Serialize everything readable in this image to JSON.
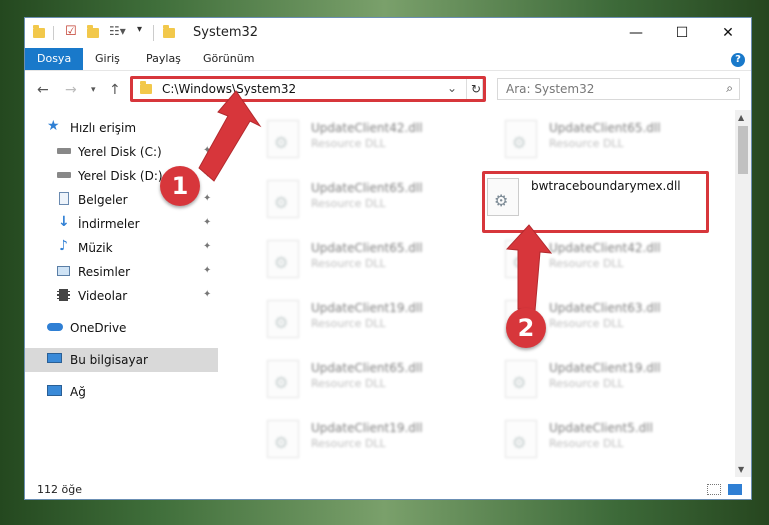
{
  "titlebar": {
    "title": "System32",
    "controls": {
      "minimize": "—",
      "maximize": "☐",
      "close": "✕"
    }
  },
  "ribbon": {
    "tabs": [
      "Dosya",
      "Giriş",
      "Paylaş",
      "Görünüm"
    ],
    "active_tab": "Dosya",
    "help": "?"
  },
  "nav": {
    "address": "C:\\Windows\\System32",
    "search_placeholder": "Ara: System32"
  },
  "sidebar": {
    "quick_access": "Hızlı erişim",
    "items": [
      {
        "label": "Yerel Disk (C:)",
        "icon": "drive-icon",
        "pinned": true
      },
      {
        "label": "Yerel Disk (D:)",
        "icon": "drive-icon",
        "pinned": true
      },
      {
        "label": "Belgeler",
        "icon": "documents-icon",
        "pinned": true
      },
      {
        "label": "İndirmeler",
        "icon": "download-icon",
        "pinned": true
      },
      {
        "label": "Müzik",
        "icon": "music-icon",
        "pinned": true
      },
      {
        "label": "Resimler",
        "icon": "pictures-icon",
        "pinned": true
      },
      {
        "label": "Videolar",
        "icon": "video-icon",
        "pinned": true
      }
    ],
    "onedrive": "OneDrive",
    "this_pc": "Bu bilgisayar",
    "network": "Ağ"
  },
  "files": [
    {
      "name": "UpdateClient42.dll",
      "type": "Resource DLL",
      "blurred": true
    },
    {
      "name": "UpdateClient65.dll",
      "type": "Resource DLL",
      "blurred": true
    },
    {
      "name": "UpdateClient65.dll",
      "type": "Resource DLL",
      "blurred": true
    },
    {
      "name": "bwtraceboundarymex.dll",
      "type": "",
      "blurred": false
    },
    {
      "name": "UpdateClient65.dll",
      "type": "Resource DLL",
      "blurred": true
    },
    {
      "name": "UpdateClient42.dll",
      "type": "Resource DLL",
      "blurred": true
    },
    {
      "name": "UpdateClient19.dll",
      "type": "Resource DLL",
      "blurred": true
    },
    {
      "name": "UpdateClient63.dll",
      "type": "Resource DLL",
      "blurred": true
    },
    {
      "name": "UpdateClient65.dll",
      "type": "Resource DLL",
      "blurred": true
    },
    {
      "name": "UpdateClient19.dll",
      "type": "Resource DLL",
      "blurred": true
    },
    {
      "name": "UpdateClient19.dll",
      "type": "Resource DLL",
      "blurred": true
    },
    {
      "name": "UpdateClient5.dll",
      "type": "Resource DLL",
      "blurred": true
    }
  ],
  "status": {
    "item_count": "112 öğe"
  },
  "annotations": {
    "marker1": "1",
    "marker2": "2"
  },
  "colors": {
    "accent": "#1979ca",
    "highlight": "#d7363b"
  }
}
